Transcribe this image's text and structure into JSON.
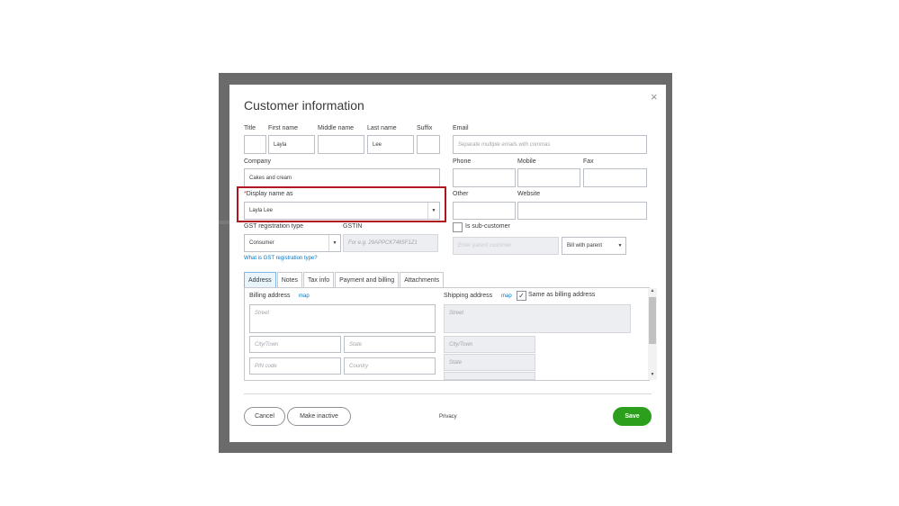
{
  "dialog": {
    "title": "Customer information",
    "close_glyph": "×"
  },
  "name": {
    "title_label": "Title",
    "title_value": "",
    "first_label": "First name",
    "first_value": "Layla",
    "middle_label": "Middle name",
    "middle_value": "",
    "last_label": "Last name",
    "last_value": "Lee",
    "suffix_label": "Suffix",
    "suffix_value": ""
  },
  "email": {
    "label": "Email",
    "placeholder": "Separate multiple emails with commas"
  },
  "company": {
    "label": "Company",
    "value": "Cakes and cream"
  },
  "phone": {
    "label": "Phone",
    "value": ""
  },
  "mobile": {
    "label": "Mobile",
    "value": ""
  },
  "fax": {
    "label": "Fax",
    "value": ""
  },
  "display_name": {
    "required_mark": "*",
    "label": "Display name as",
    "value": "Layla Lee",
    "arrow": "▼"
  },
  "other": {
    "label": "Other",
    "value": ""
  },
  "website": {
    "label": "Website",
    "value": ""
  },
  "gst": {
    "type_label": "GST registration type",
    "type_value": "Consumer",
    "gstin_label": "GSTIN",
    "gstin_placeholder": "For e.g. 29APPCK7465F1Z1",
    "help_link": "What is GST registration type?"
  },
  "sub_customer": {
    "label": "Is sub-customer",
    "checked": false,
    "parent_placeholder": "Enter parent customer",
    "bill_with": "Bill with parent"
  },
  "tabs": [
    {
      "label": "Address",
      "active": true
    },
    {
      "label": "Notes",
      "active": false
    },
    {
      "label": "Tax info",
      "active": false
    },
    {
      "label": "Payment and billing",
      "active": false
    },
    {
      "label": "Attachments",
      "active": false
    }
  ],
  "billing": {
    "label": "Billing address",
    "map_link": "map",
    "street": "Street",
    "city": "City/Town",
    "state": "State",
    "pin": "PIN code",
    "country": "Country"
  },
  "shipping": {
    "label": "Shipping address",
    "map_link": "map",
    "same_as_label": "Same as billing address",
    "same_as_checked": true,
    "check_glyph": "✓",
    "street": "Street",
    "city": "City/Town",
    "state": "State"
  },
  "scrollbar": {
    "up": "▲",
    "down": "▼"
  },
  "footer": {
    "cancel": "Cancel",
    "make_inactive": "Make inactive",
    "privacy": "Privacy",
    "save": "Save"
  },
  "colors": {
    "backdrop": "#6b6b6b",
    "highlight_border": "#b0151e",
    "save_green": "#2ca01c",
    "link_blue": "#0077c5"
  }
}
